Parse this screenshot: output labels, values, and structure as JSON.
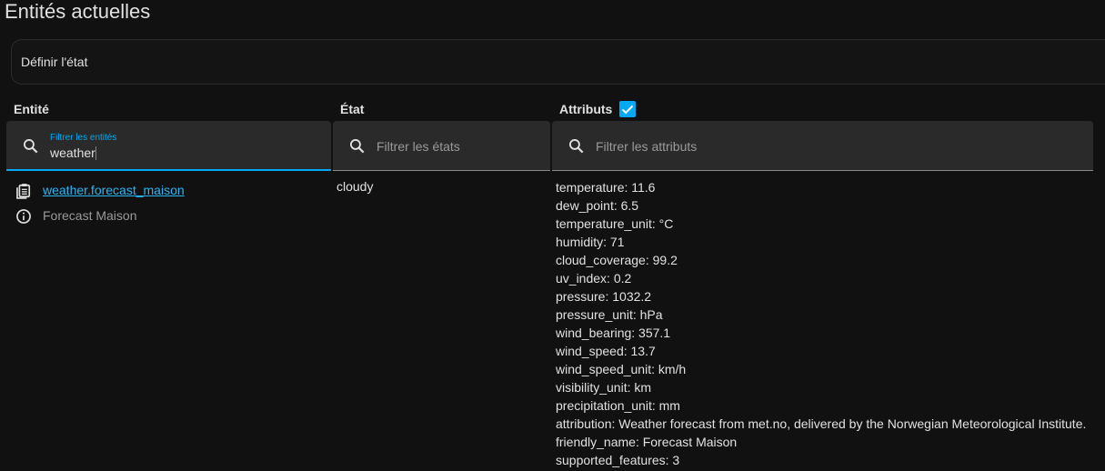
{
  "page": {
    "title": "Entités actuelles"
  },
  "set_state": {
    "label": "Définir l'état"
  },
  "columns": {
    "entity": "Entité",
    "state": "État",
    "attributes": "Attributs",
    "attributes_checked": true
  },
  "filters": {
    "entity": {
      "label": "Filtrer les entités",
      "value": "weather"
    },
    "state": {
      "placeholder": "Filtrer les états"
    },
    "attributes": {
      "placeholder": "Filtrer les attributs"
    }
  },
  "row": {
    "entity_id": "weather.forecast_maison",
    "friendly_name": "Forecast Maison",
    "state": "cloudy",
    "attributes": [
      "temperature: 11.6",
      "dew_point: 6.5",
      "temperature_unit: °C",
      "humidity: 71",
      "cloud_coverage: 99.2",
      "uv_index: 0.2",
      "pressure: 1032.2",
      "pressure_unit: hPa",
      "wind_bearing: 357.1",
      "wind_speed: 13.7",
      "wind_speed_unit: km/h",
      "visibility_unit: km",
      "precipitation_unit: mm",
      "attribution: Weather forecast from met.no, delivered by the Norwegian Meteorological Institute.",
      "friendly_name: Forecast Maison",
      "supported_features: 3"
    ]
  },
  "icons": {
    "search": "search-icon",
    "clipboard": "clipboard-list-icon",
    "info": "info-circle-icon",
    "check": "check-icon"
  },
  "colors": {
    "accent": "#03a9f4",
    "link": "#29b6f6",
    "background": "#111111",
    "filter_bg": "#2a2a2a"
  }
}
